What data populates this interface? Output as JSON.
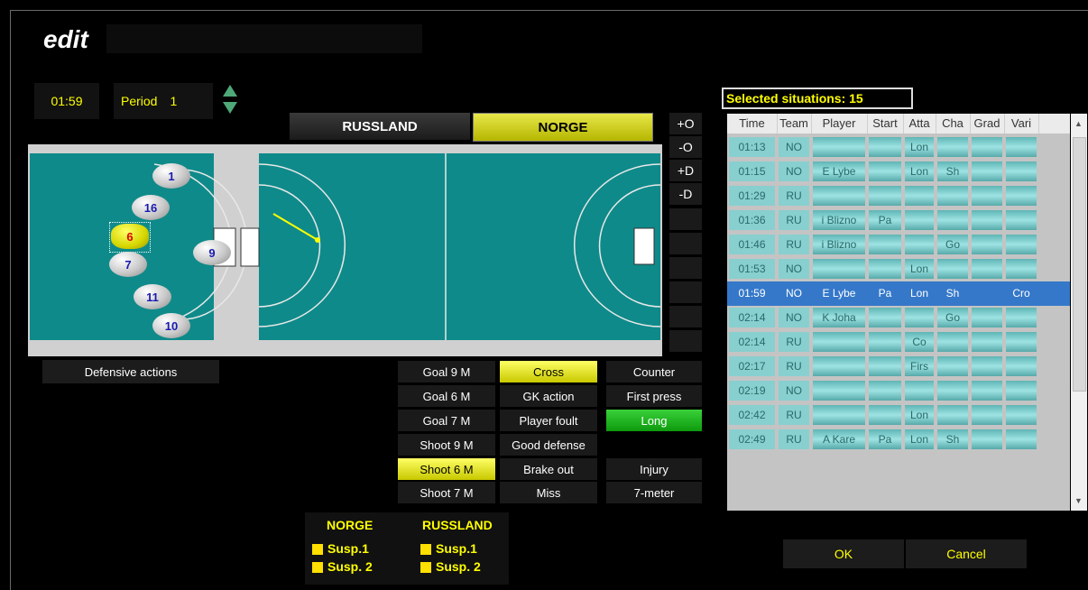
{
  "window": {
    "title": "edit"
  },
  "clock": {
    "time": "01:59",
    "period_label": "Period",
    "period_value": "1"
  },
  "teams": {
    "home": "RUSSLAND",
    "away": "NORGE",
    "selected": "NORGE"
  },
  "side_buttons": [
    "+O",
    "-O",
    "+D",
    "-D"
  ],
  "players": [
    "1",
    "16",
    "6",
    "7",
    "9",
    "11",
    "10"
  ],
  "selected_player": "6",
  "defensive_actions_label": "Defensive actions",
  "actions": {
    "col1": [
      "Goal 9 M",
      "Goal 6 M",
      "Goal 7 M",
      "Shoot 9 M",
      "Shoot 6 M",
      "Shoot 7 M"
    ],
    "col2": [
      "Cross",
      "GK action",
      "Player foult",
      "Good defense",
      "Brake out",
      "Miss"
    ],
    "col3": [
      "Counter",
      "First press",
      "Long",
      "Injury",
      "7-meter"
    ],
    "active_col1": "Shoot 6 M",
    "active_col2": "Cross",
    "active_col3": "Long"
  },
  "suspensions": {
    "norge": {
      "name": "NORGE",
      "s1": "Susp.1",
      "s2": "Susp. 2"
    },
    "russland": {
      "name": "RUSSLAND",
      "s1": "Susp.1",
      "s2": "Susp. 2"
    }
  },
  "selected_situations": "Selected situations: 15",
  "table": {
    "columns": [
      "Time",
      "Team",
      "Player",
      "Start",
      "Atta",
      "Cha",
      "Grad",
      "Vari"
    ],
    "rows": [
      [
        "01:13",
        "NO",
        "",
        "",
        "Lon",
        "",
        "",
        ""
      ],
      [
        "01:15",
        "NO",
        "E Lybe",
        "",
        "Lon",
        "Sh",
        "",
        ""
      ],
      [
        "01:29",
        "RU",
        "",
        "",
        "",
        "",
        "",
        ""
      ],
      [
        "01:36",
        "RU",
        "i Blizno",
        "Pa",
        "",
        "",
        "",
        ""
      ],
      [
        "01:46",
        "RU",
        "i Blizno",
        "",
        "",
        "Go",
        "",
        ""
      ],
      [
        "01:53",
        "NO",
        "",
        "",
        "Lon",
        "",
        "",
        ""
      ],
      [
        "01:59",
        "NO",
        "E Lybe",
        "Pa",
        "Lon",
        "Sh",
        "",
        "Cro"
      ],
      [
        "02:14",
        "NO",
        "K Joha",
        "",
        "",
        "Go",
        "",
        ""
      ],
      [
        "02:14",
        "RU",
        "",
        "",
        "Co",
        "",
        "",
        ""
      ],
      [
        "02:17",
        "RU",
        "",
        "",
        "Firs",
        "",
        "",
        ""
      ],
      [
        "02:19",
        "NO",
        "",
        "",
        "",
        "",
        "",
        ""
      ],
      [
        "02:42",
        "RU",
        "",
        "",
        "Lon",
        "",
        "",
        ""
      ],
      [
        "02:49",
        "RU",
        "A Kare",
        "Pa",
        "Lon",
        "Sh",
        "",
        ""
      ]
    ],
    "highlighted_row": 6
  },
  "buttons": {
    "ok": "OK",
    "cancel": "Cancel"
  },
  "colors": {
    "court": "#0f8a8a",
    "accent_yellow": "#ffff00",
    "selected_row": "#3578c9"
  }
}
